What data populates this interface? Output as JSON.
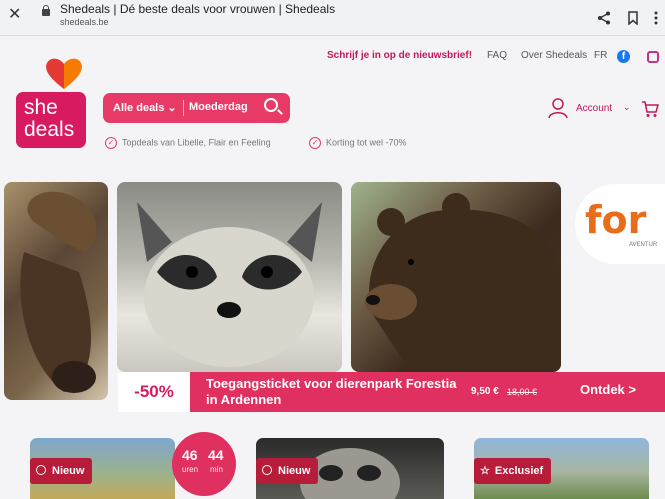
{
  "browser": {
    "tab_title": "Shedeals | Dé beste deals voor vrouwen | Shedeals",
    "url": "shedeals.be",
    "icons": [
      "close-icon",
      "lock-icon",
      "share-icon",
      "bookmark-icon",
      "more-icon"
    ]
  },
  "toplinks": {
    "newsletter": "Schrijf je in op de nieuwsbrief!",
    "faq": "FAQ",
    "about": "Over Shedeals",
    "lang": "FR",
    "facebook": "f"
  },
  "logo": {
    "line1": "she",
    "line2": "deals"
  },
  "search": {
    "dropdown_label": "Alle deals",
    "query": "Moederdag"
  },
  "usps": [
    "Topdeals van Libelle, Flair en Feeling",
    "Korting tot wel -70%"
  ],
  "account": {
    "label": "Account"
  },
  "hero": {
    "discount": "-50%",
    "title_line1": "Toegangsticket voor dierenpark Forestia",
    "title_line2": "in Ardennen",
    "price": "9,50 €",
    "old_price": "18,00 €",
    "cta": "Ontdek >",
    "brand_partial": "for",
    "brand_sub": "AVENTUR"
  },
  "cards": [
    {
      "badge": "Nieuw"
    },
    {
      "badge": "Nieuw"
    },
    {
      "badge": "Exclusief"
    }
  ],
  "timer": {
    "hours": "46",
    "hours_unit": "uren",
    "minutes": "44",
    "minutes_unit": "min"
  },
  "colors": {
    "brand": "#d81b60",
    "accent": "#e0305f"
  }
}
